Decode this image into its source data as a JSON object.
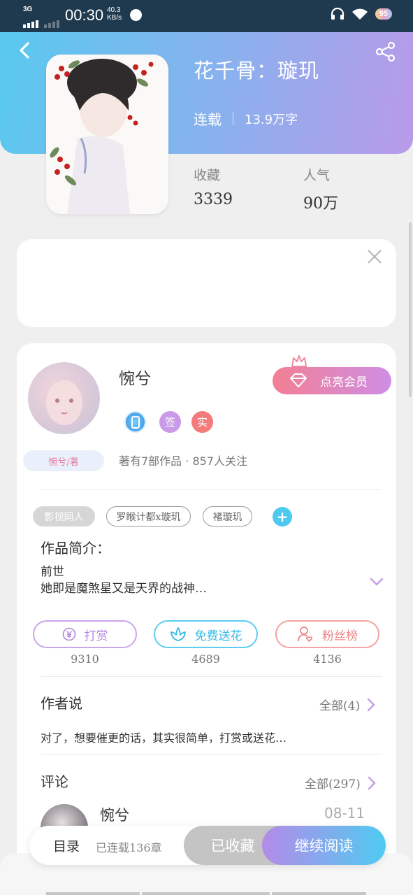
{
  "status_bar": {
    "network": "3G",
    "time": "00:30",
    "speed_value": "40.3",
    "speed_unit": "KB/s",
    "battery": "95"
  },
  "colors": {
    "hero_start": "#58c9ef",
    "hero_end": "#b99ae8",
    "accent_blue": "#4dc8ef",
    "accent_purple": "#b483e0",
    "accent_red": "#ee8585"
  },
  "book": {
    "title": "花千骨：璇玑",
    "status": "连载",
    "word_count": "13.9万字",
    "favorites_label": "收藏",
    "favorites_value": "3339",
    "popularity_label": "人气",
    "popularity_value": "90万"
  },
  "author": {
    "name": "惋兮",
    "vip_button": "点亮会员",
    "badges": [
      "签",
      "实"
    ],
    "tag": "惋兮/著",
    "meta": "著有7部作品 · 857人关注"
  },
  "tags": [
    "影视同人",
    "罗睺计都x璇玑",
    "褚璇玑"
  ],
  "tag_add": "+",
  "intro": {
    "heading": "作品简介：",
    "line1": "前世",
    "line2": "她即是魔煞星又是天界的战神…"
  },
  "actions": [
    {
      "label": "打赏",
      "count": "9310"
    },
    {
      "label": "免费送花",
      "count": "4689"
    },
    {
      "label": "粉丝榜",
      "count": "4136"
    }
  ],
  "author_says": {
    "heading": "作者说",
    "more": "全部(4)",
    "text": "对了，想要催更的话，其实很简单，打赏或送花…"
  },
  "comments": {
    "heading": "评论",
    "more": "全部(297)",
    "first_user": "惋兮",
    "first_date": "08-11"
  },
  "bottom_bar": {
    "toc": "目录",
    "chapters": "已连载136章",
    "favorited": "已收藏",
    "continue": "继续阅读"
  },
  "icons": [
    "back-icon",
    "share-icon",
    "close-icon",
    "crown-icon",
    "diamond-icon",
    "phone-badge-icon",
    "yen-icon",
    "flower-icon",
    "user-heart-icon",
    "chevron-down-icon",
    "chevron-right-icon"
  ]
}
